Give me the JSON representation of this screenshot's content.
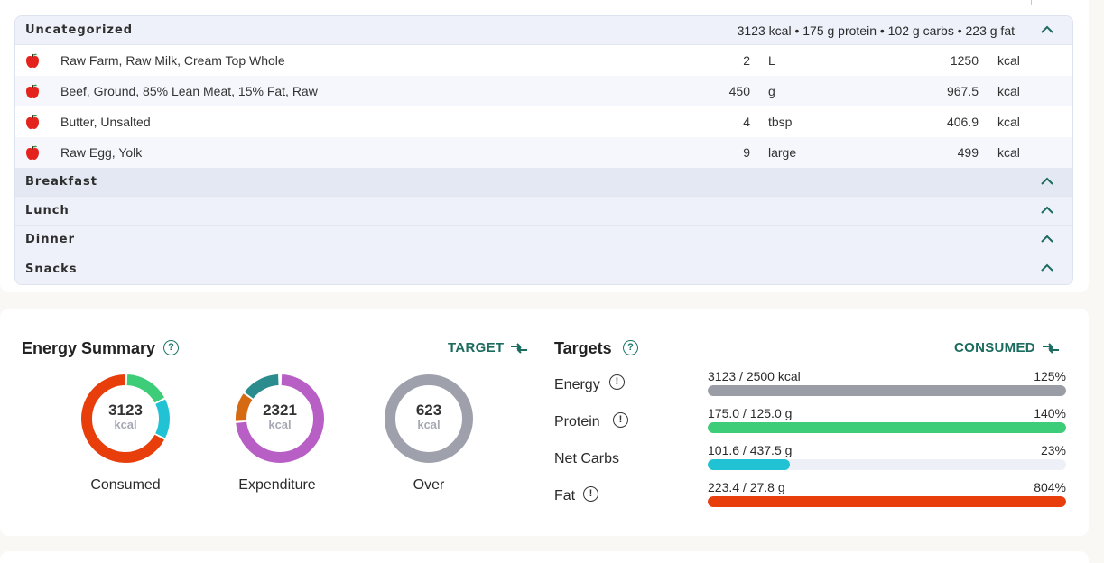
{
  "diary": {
    "groups": [
      {
        "name": "Uncategorized",
        "summary": "3123 kcal • 175 g protein • 102 g carbs • 223 g fat",
        "items": [
          {
            "name": "Raw Farm, Raw Milk, Cream Top Whole",
            "qty": "2",
            "unit": "L",
            "kcal": "1250",
            "kcal_unit": "kcal"
          },
          {
            "name": "Beef, Ground, 85% Lean Meat, 15% Fat, Raw",
            "qty": "450",
            "unit": "g",
            "kcal": "967.5",
            "kcal_unit": "kcal"
          },
          {
            "name": "Butter, Unsalted",
            "qty": "4",
            "unit": "tbsp",
            "kcal": "406.9",
            "kcal_unit": "kcal"
          },
          {
            "name": "Raw Egg, Yolk",
            "qty": "9",
            "unit": "large",
            "kcal": "499",
            "kcal_unit": "kcal"
          }
        ]
      },
      {
        "name": "Breakfast"
      },
      {
        "name": "Lunch"
      },
      {
        "name": "Dinner"
      },
      {
        "name": "Snacks"
      }
    ]
  },
  "energy": {
    "title": "Energy Summary",
    "help": "?",
    "toggle": "TARGET",
    "donuts": [
      {
        "value": "3123",
        "unit": "kcal",
        "label": "Consumed"
      },
      {
        "value": "2321",
        "unit": "kcal",
        "label": "Expenditure"
      },
      {
        "value": "623",
        "unit": "kcal",
        "label": "Over"
      }
    ]
  },
  "targets": {
    "title": "Targets",
    "help": "?",
    "toggle": "CONSUMED",
    "warn": "!",
    "rows": [
      {
        "name": "Energy",
        "value": "3123 / 2500 kcal",
        "pct": "125%",
        "fill": 1.0,
        "color": "#9a9ca6"
      },
      {
        "name": "Protein",
        "value": "175.0 / 125.0 g",
        "pct": "140%",
        "fill": 1.0,
        "color": "#3dcc78"
      },
      {
        "name": "Net Carbs",
        "value": "101.6 / 437.5 g",
        "pct": "23%",
        "fill": 0.23,
        "color": "#21c2d3"
      },
      {
        "name": "Fat",
        "value": "223.4 / 27.8 g",
        "pct": "804%",
        "fill": 1.0,
        "color": "#e83e0c"
      }
    ]
  },
  "colors": {
    "accent": "#1b6b5f",
    "consumed_fat": "#e83e0c",
    "consumed_protein": "#3dcc78",
    "consumed_carbs": "#21c2d3",
    "expenditure_activity": "#b85fc5",
    "expenditure_teal": "#2a8c8c",
    "expenditure_orange": "#d66a12",
    "over_gray": "#9ea1ab"
  }
}
